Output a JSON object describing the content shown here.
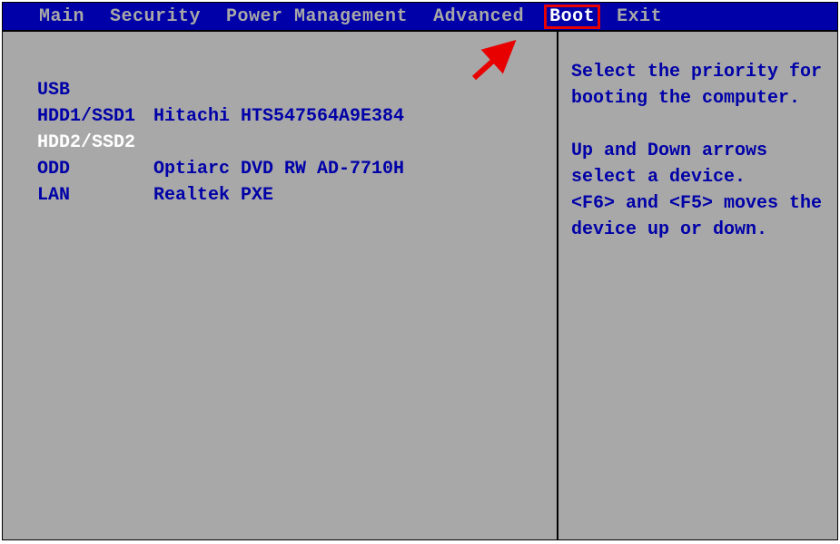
{
  "menubar": {
    "items": [
      {
        "label": "Main"
      },
      {
        "label": "Security"
      },
      {
        "label": "Power Management"
      },
      {
        "label": "Advanced"
      },
      {
        "label": "Boot",
        "highlighted": true
      },
      {
        "label": "Exit"
      }
    ]
  },
  "boot_devices": [
    {
      "label": "USB",
      "name": ""
    },
    {
      "label": "HDD1/SSD1",
      "name": "Hitachi HTS547564A9E384"
    },
    {
      "label": "HDD2/SSD2",
      "name": "",
      "selected": true
    },
    {
      "label": "ODD",
      "name": "Optiarc DVD RW AD-7710H"
    },
    {
      "label": "LAN",
      "name": "Realtek PXE"
    }
  ],
  "help": {
    "line1": "Select the priority for",
    "line2": "booting the computer.",
    "line3": "Up and Down arrows",
    "line4": "select a device.",
    "line5": "<F6> and <F5> moves the",
    "line6": "device up or down."
  },
  "annotation": {
    "arrow_color": "#e80000"
  }
}
